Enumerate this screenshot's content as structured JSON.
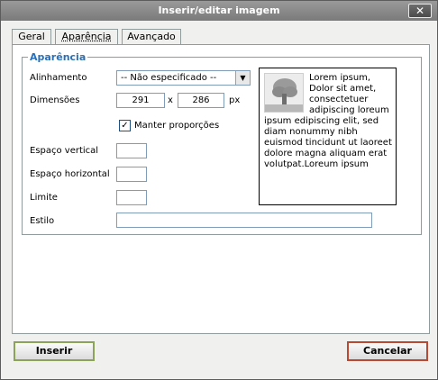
{
  "window": {
    "title": "Inserir/editar imagem"
  },
  "tabs": [
    {
      "label": "Geral"
    },
    {
      "label": "Aparência"
    },
    {
      "label": "Avançado"
    }
  ],
  "fieldset": {
    "legend": "Aparência"
  },
  "form": {
    "alignment_label": "Alinhamento",
    "alignment_value": "-- Não especificado --",
    "dimensions_label": "Dimensões",
    "width_value": "291",
    "times_sign": "x",
    "height_value": "286",
    "unit": "px",
    "keep_proportions_label": "Manter proporções",
    "keep_proportions_checked": true,
    "vspace_label": "Espaço vertical",
    "vspace_value": "",
    "hspace_label": "Espaço horizontal",
    "hspace_value": "",
    "border_label": "Limite",
    "border_value": "",
    "style_label": "Estilo",
    "style_value": ""
  },
  "preview": {
    "text": "Lorem ipsum, Dolor sit amet, consectetuer adipiscing loreum ipsum edipiscing elit, sed diam nonummy nibh euismod tincidunt ut laoreet dolore magna aliquam erat volutpat.Loreum ipsum"
  },
  "buttons": {
    "insert_label": "Inserir",
    "cancel_label": "Cancelar"
  },
  "icons": {
    "close": "close-icon",
    "dropdown": "chevron-down-icon",
    "check": "checkmark-icon"
  },
  "colors": {
    "legend": "#2b6fb6",
    "insert_border": "#8ca35a",
    "cancel_border": "#b84a33"
  }
}
